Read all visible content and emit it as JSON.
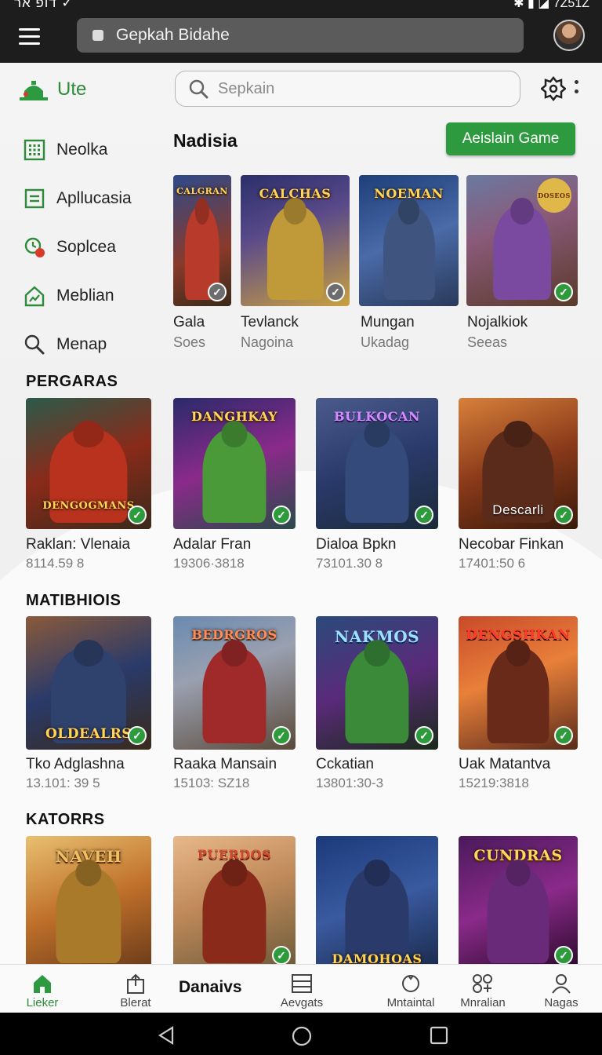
{
  "status_bar": {
    "left": "דופ אר ✓",
    "right": "✱ ▮ ◪ 7Z51Z"
  },
  "top_bar": {
    "url": "Gepkah Bidahe"
  },
  "app": {
    "brand": "Ute",
    "search_placeholder": "Sepkain"
  },
  "side_nav": [
    {
      "label": "Neolka",
      "icon": "grid-icon"
    },
    {
      "label": "Apllucasia",
      "icon": "list-box-icon"
    },
    {
      "label": "Soplcea",
      "icon": "clock-badge-icon"
    },
    {
      "label": "Meblian",
      "icon": "house-chart-icon"
    },
    {
      "label": "Menap",
      "icon": "search-icon"
    }
  ],
  "featured": {
    "title": "Nadisia",
    "cta": "Aeislain Game",
    "items": [
      {
        "name": "Gala",
        "sub": "Soes",
        "art": "CALGRAN",
        "check": "grey"
      },
      {
        "name": "Tevlanck",
        "sub": "Nagoina",
        "art": "CALCHAS",
        "check": "grey"
      },
      {
        "name": "Mungan",
        "sub": "Ukadag",
        "art": "NOEMAN",
        "check": "none"
      },
      {
        "name": "Nojalkiok",
        "sub": "Seeas",
        "art": "DOSEOS",
        "check": "green"
      }
    ]
  },
  "sections": [
    {
      "title": "PERGARAS",
      "games": [
        {
          "name": "Raklan: Vlenaia",
          "meta": "8114.59 8",
          "art": "DENGOGMANS"
        },
        {
          "name": "Adalar Fran",
          "meta": "19306·3818",
          "art": "DANGHKAY"
        },
        {
          "name": "Dialoa Bpkn",
          "meta": "73101.30 8",
          "art": "BULKOCAN"
        },
        {
          "name": "Necobar Finkan",
          "meta": "17401:50 6",
          "art": "Descarli"
        }
      ]
    },
    {
      "title": "MATIBHIOIS",
      "games": [
        {
          "name": "Tko Adglashna",
          "meta": "13.101: 39 5",
          "art": "OLDEALRS"
        },
        {
          "name": "Raaka Mansain",
          "meta": "15103: SZ18",
          "art": "BEDRGROS"
        },
        {
          "name": "Cckatian",
          "meta": "13801:30-3",
          "art": "NAKMOS"
        },
        {
          "name": "Uak Matantva",
          "meta": "15219:3818",
          "art": "DENGSHKAN"
        }
      ]
    },
    {
      "title": "KATORRS",
      "games": [
        {
          "name": "",
          "meta": "",
          "art": "NAVEH"
        },
        {
          "name": "",
          "meta": "",
          "art": "PUERDOS"
        },
        {
          "name": "",
          "meta": "",
          "art": "DAMOHOAS"
        },
        {
          "name": "",
          "meta": "",
          "art": "CUNDRAS"
        }
      ]
    }
  ],
  "bottom_nav": {
    "title": "Danaivs",
    "items": [
      {
        "label": "Lieker",
        "icon": "home-icon",
        "active": true
      },
      {
        "label": "Blerat",
        "icon": "upload-box-icon",
        "active": false
      },
      {
        "label": "Aevgats",
        "icon": "list-icon",
        "active": false
      },
      {
        "label": "Mntaintal",
        "icon": "circle-icon",
        "active": false
      },
      {
        "label": "Mnralian",
        "icon": "apps-icon",
        "active": false
      },
      {
        "label": "Nagas",
        "icon": "person-icon",
        "active": false
      }
    ]
  },
  "colors": {
    "accent": "#2e9a3f",
    "topbar": "#1d1d1d",
    "check": "#2d9a3c"
  }
}
